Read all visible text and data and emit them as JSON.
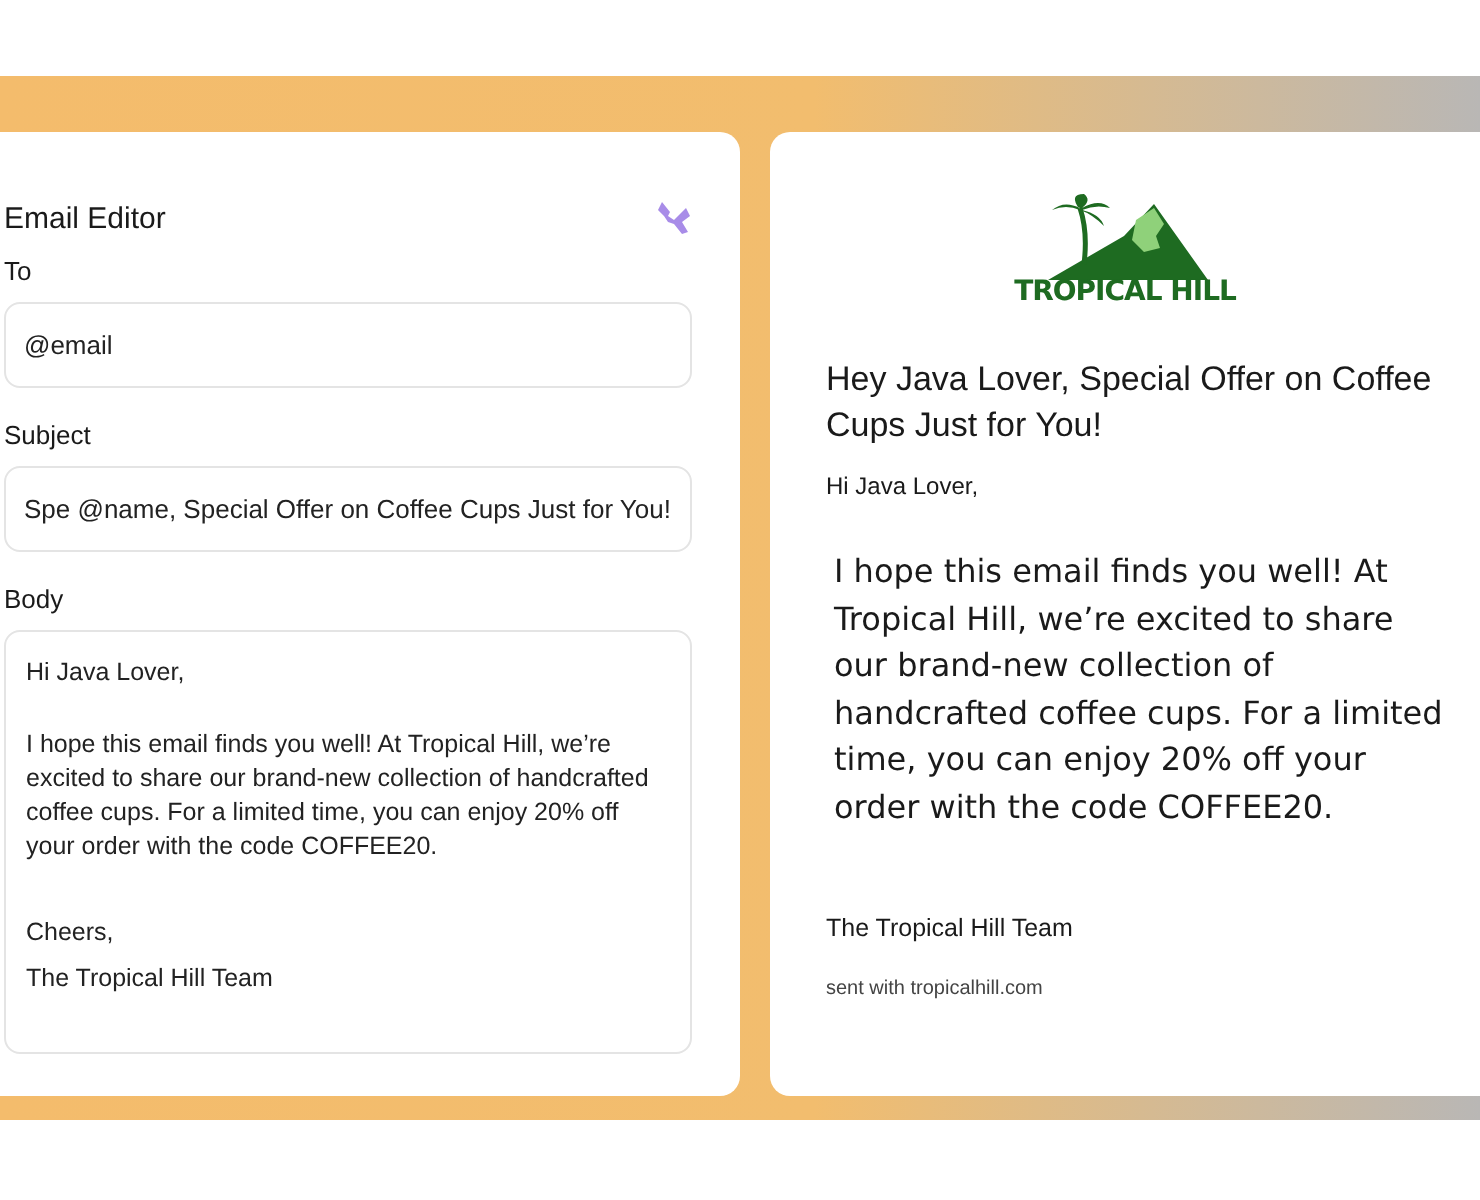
{
  "editor": {
    "title": "Email Editor",
    "fields": [
      {
        "label": "To",
        "value": "@email"
      },
      {
        "label": "Subject",
        "value": "Spe @name, Special Offer on Coffee Cups Just for You!"
      }
    ],
    "body": {
      "label": "Body",
      "paragraphs": [
        "Hi Java Lover,",
        "I hope this email finds you well! At Tropical Hill, we’re excited to share our brand-new collection of handcrafted coffee cups. For a limited time, you can enjoy 20% off your order with the code COFFEE20.",
        "Cheers,",
        "The Tropical Hill Team"
      ]
    }
  },
  "preview": {
    "logo_text": "TROPICAL HILL",
    "subject": "Hey Java Lover, Special Offer on Coffee Cups Just for You!",
    "greeting": "Hi Java Lover,",
    "message": "I hope this email finds you well! At Tropical Hill, we’re excited to share our brand-new collection of handcrafted coffee cups. For a limited time, you can enjoy 20% off your order with the code COFFEE20.",
    "signature": "The Tropical Hill Team",
    "footer": "sent with tropicalhill.com"
  }
}
